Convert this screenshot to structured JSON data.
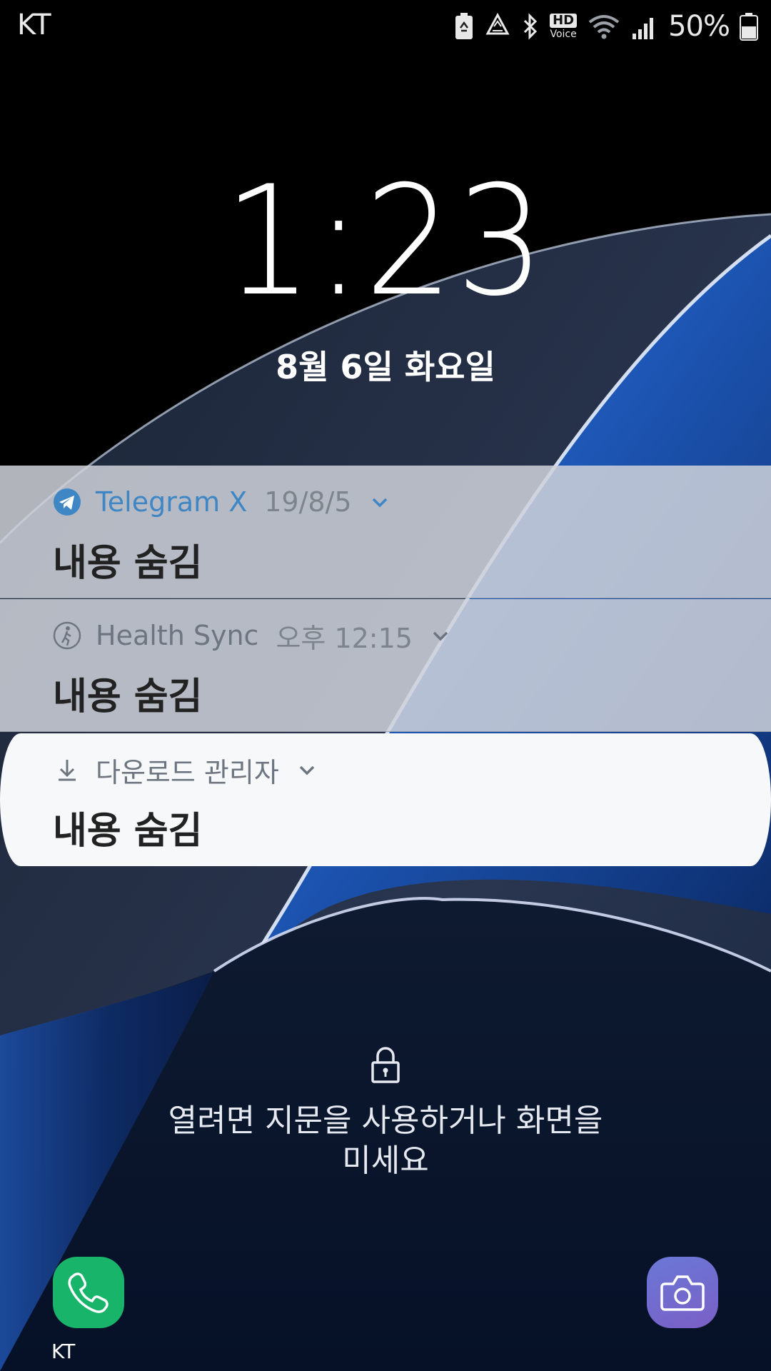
{
  "status_bar": {
    "carrier": "KT",
    "battery_percent": "50%",
    "icons": [
      "battery-saver-icon",
      "recycle-icon",
      "bluetooth-icon",
      "hd-voice-icon",
      "wifi-icon",
      "signal-icon",
      "battery-icon"
    ],
    "hd_label": "HD",
    "voice_label": "Voice"
  },
  "lockscreen": {
    "time": "1:23",
    "date": "8월 6일 화요일",
    "unlock_hint": "열려면 지문을 사용하거나 화면을\n미세요"
  },
  "notifications": [
    {
      "app": "Telegram X",
      "time": "19/8/5",
      "body": "내용 숨김",
      "icon": "telegram-icon",
      "accent": "#3f86c4"
    },
    {
      "app": "Health Sync",
      "time": "오후 12:15",
      "body": "내용 숨김",
      "icon": "walking-icon",
      "accent": "#6d7680"
    },
    {
      "app": "다운로드 관리자",
      "time": "",
      "body": "내용 숨김",
      "icon": "download-icon",
      "accent": "#6d7680"
    }
  ],
  "shortcuts": {
    "phone_label": "KT",
    "phone_icon": "phone-icon",
    "camera_icon": "camera-icon"
  },
  "colors": {
    "phone_green": "#17b46a",
    "camera_purple": "#7a5fc6",
    "wallpaper_blue": "#1f5fc4"
  }
}
